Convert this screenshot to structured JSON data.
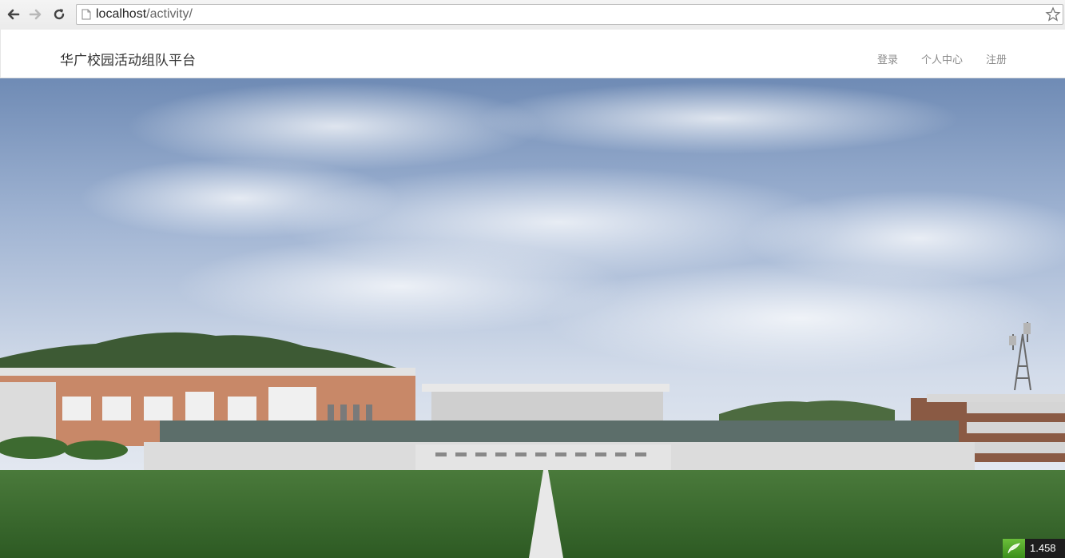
{
  "browser": {
    "url_host": "localhost",
    "url_path": "/activity/"
  },
  "site": {
    "brand": "华广校园活动组队平台",
    "nav": {
      "login": "登录",
      "profile": "个人中心",
      "register": "注册"
    }
  },
  "hero": {
    "image": "campus-stadium-photo"
  },
  "widget": {
    "value": "1.458"
  }
}
